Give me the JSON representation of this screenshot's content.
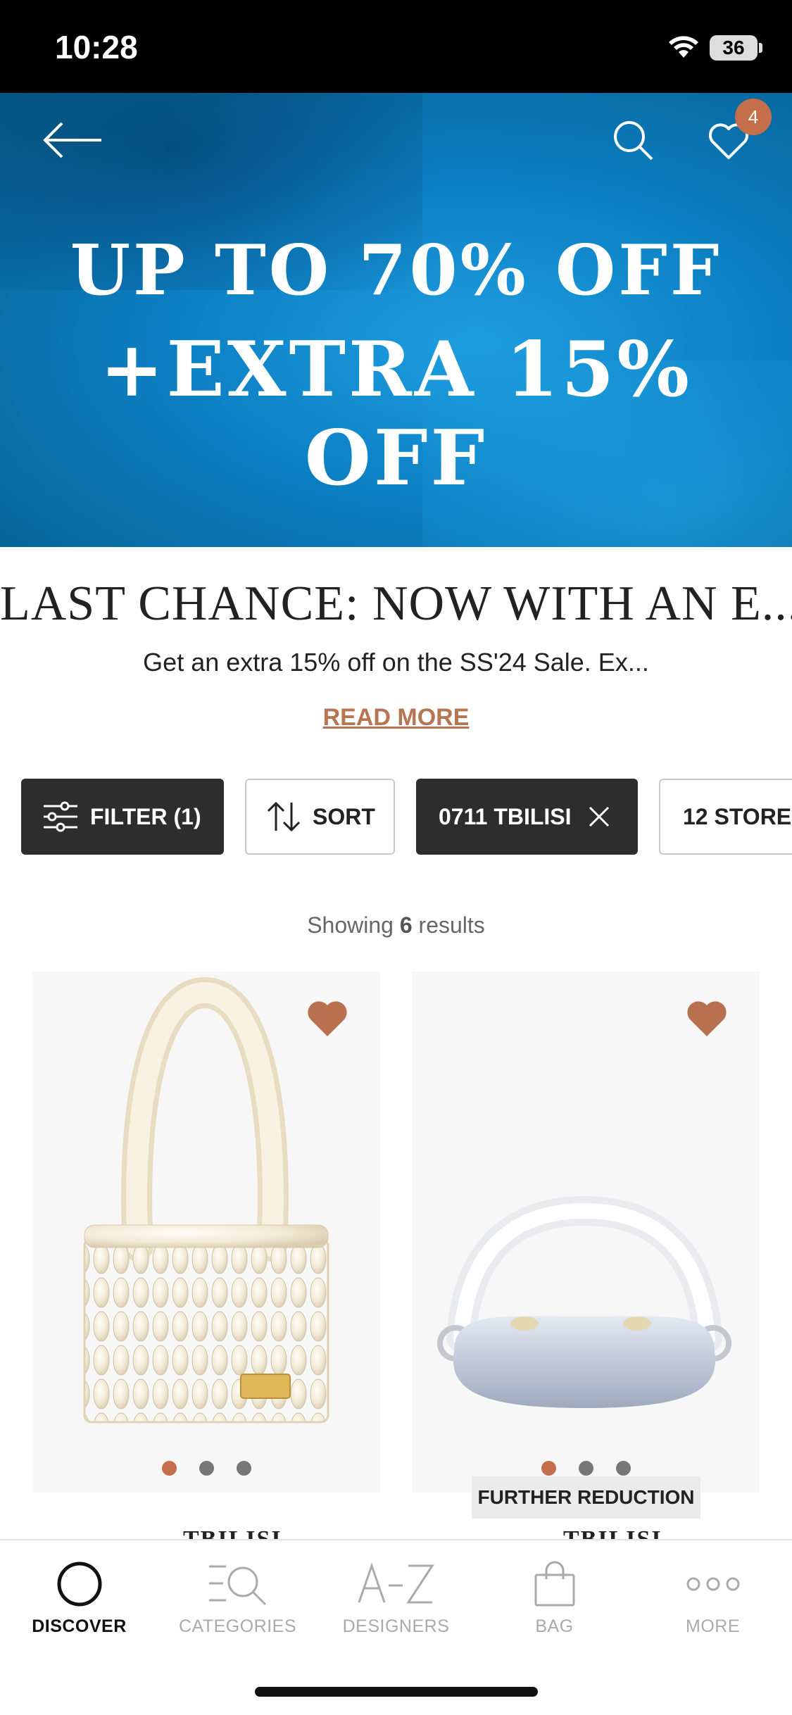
{
  "status_bar": {
    "time": "10:28",
    "battery": "36"
  },
  "banner": {
    "line1": "UP TO 70% OFF",
    "line2": "+EXTRA 15% OFF",
    "wishlist_count": "4"
  },
  "header": {
    "title": "LAST CHANCE: NOW WITH AN E...",
    "subtitle": "Get an extra 15% off on the SS'24 Sale. Ex...",
    "read_more": "READ MORE"
  },
  "chips": {
    "filter": "FILTER (1)",
    "sort": "SORT",
    "store": "0711 TBILISI",
    "stores": "12 STORE"
  },
  "results": {
    "prefix": "Showing",
    "count": "6",
    "suffix": "results"
  },
  "products": [
    {
      "store": "TBILISI",
      "favorited": true,
      "image_count": 3
    },
    {
      "store": "TBILISI",
      "favorited": true,
      "image_count": 3,
      "badge": "FURTHER REDUCTION"
    }
  ],
  "colors": {
    "accent": "#c46e4c",
    "dark_chip": "#2d2d2d",
    "banner": "#0c7fc3"
  },
  "bottom_nav": [
    {
      "label": "DISCOVER",
      "icon": "discover-icon",
      "active": true
    },
    {
      "label": "CATEGORIES",
      "icon": "categories-icon",
      "active": false
    },
    {
      "label": "DESIGNERS",
      "icon": "designers-icon",
      "active": false
    },
    {
      "label": "BAG",
      "icon": "bag-icon",
      "active": false
    },
    {
      "label": "MORE",
      "icon": "more-icon",
      "active": false
    }
  ]
}
